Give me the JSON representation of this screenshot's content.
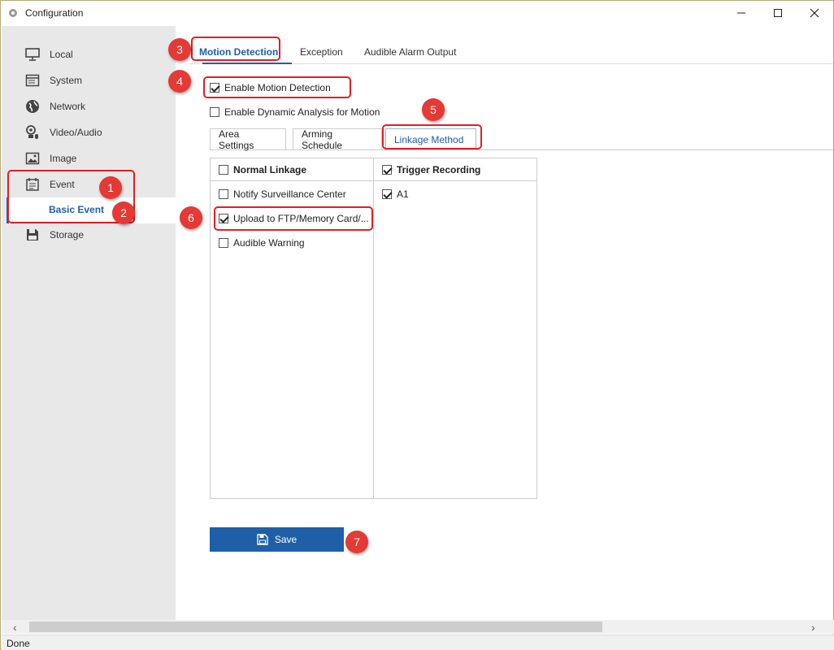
{
  "window": {
    "title": "Configuration"
  },
  "sidebar": {
    "items": [
      {
        "label": "Local",
        "icon": "monitor-icon"
      },
      {
        "label": "System",
        "icon": "system-window-icon"
      },
      {
        "label": "Network",
        "icon": "globe-icon"
      },
      {
        "label": "Video/Audio",
        "icon": "camera-mic-icon"
      },
      {
        "label": "Image",
        "icon": "image-icon"
      },
      {
        "label": "Event",
        "icon": "calendar-icon"
      },
      {
        "label": "Storage",
        "icon": "floppy-icon"
      }
    ],
    "sub_item": {
      "label": "Basic Event"
    }
  },
  "tabs": {
    "items": [
      {
        "label": "Motion Detection",
        "active": true
      },
      {
        "label": "Exception",
        "active": false
      },
      {
        "label": "Audible Alarm Output",
        "active": false
      }
    ]
  },
  "options": {
    "enable_motion_detection": {
      "label": "Enable Motion Detection",
      "checked": true
    },
    "enable_dynamic_analysis": {
      "label": "Enable Dynamic Analysis for Motion",
      "checked": false
    }
  },
  "subtabs": {
    "items": [
      {
        "label": "Area Settings",
        "active": false
      },
      {
        "label": "Arming Schedule",
        "active": false
      },
      {
        "label": "Linkage Method",
        "active": true
      }
    ]
  },
  "linkage": {
    "normal": {
      "header": "Normal Linkage",
      "header_checked": false,
      "items": [
        {
          "label": "Notify Surveillance Center",
          "checked": false
        },
        {
          "label": "Upload to FTP/Memory Card/...",
          "checked": true
        },
        {
          "label": "Audible Warning",
          "checked": false
        }
      ]
    },
    "trigger": {
      "header": "Trigger Recording",
      "header_checked": true,
      "items": [
        {
          "label": "A1",
          "checked": true
        }
      ]
    }
  },
  "save_button": {
    "label": "Save"
  },
  "markers": [
    "1",
    "2",
    "3",
    "4",
    "5",
    "6",
    "7"
  ],
  "status": {
    "text": "Done"
  },
  "colors": {
    "accent": "#1f5fa8",
    "marker": "#e53935",
    "sidebar_bg": "#e8e8e8"
  }
}
